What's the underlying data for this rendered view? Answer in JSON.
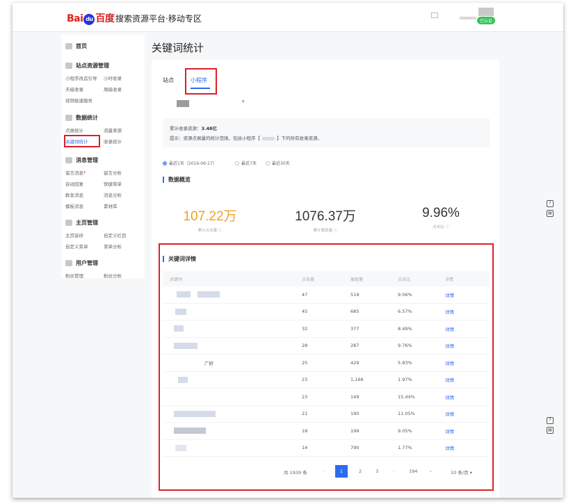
{
  "header": {
    "logo_bai": "Bai",
    "logo_paw": "du",
    "logo_du": "百度",
    "platform": "搜索资源平台·移动专区",
    "badge": "已认证"
  },
  "sidebar": {
    "home": "首页",
    "groups": [
      {
        "title": "站点资源管理",
        "items": [
          "小程序改造引导",
          "小时收录",
          "天级收录",
          "周级收录",
          "视频极速服务"
        ]
      },
      {
        "title": "数据统计",
        "items": [
          "点展统计",
          "流量来源",
          "关键词统计",
          "收录统计"
        ]
      },
      {
        "title": "消息管理",
        "items": [
          "留言消息",
          "留言分析",
          "自动回复",
          "快捷菜单",
          "群发消息",
          "消息分析",
          "模板消息",
          "素材库"
        ]
      },
      {
        "title": "主页管理",
        "items": [
          "主页装修",
          "自定义栏目",
          "自定义菜单",
          "菜单分析"
        ]
      },
      {
        "title": "用户管理",
        "items": [
          "粉丝管理",
          "粉丝分析"
        ]
      }
    ]
  },
  "page_title": "关键词统计",
  "tabs": {
    "site": "站点",
    "mini": "小程序"
  },
  "info": {
    "line1_label": "累计收录资源：",
    "line1_value": "3.48亿",
    "line2_prefix": "提示：资源点展量的统计范围，包括小程序【",
    "line2_suffix": "】下的所有收录资源。"
  },
  "ranges": {
    "day": "最近1天（2019-06-17）",
    "week": "最近7天",
    "month": "最近30天"
  },
  "overview": {
    "title": "数据概览",
    "stats": [
      {
        "value": "107.22万",
        "label": "累计点击量"
      },
      {
        "value": "1076.37万",
        "label": "累计展现量"
      },
      {
        "value": "9.96%",
        "label": "点击比"
      }
    ]
  },
  "keywords": {
    "title": "关键词详情",
    "columns": [
      "关键词",
      "点击量",
      "展现量",
      "点击比",
      "详情"
    ],
    "rows": [
      {
        "kw": "",
        "clicks": "47",
        "views": "519",
        "ratio": "9.06%",
        "detail": "详情"
      },
      {
        "kw": "",
        "clicks": "45",
        "views": "685",
        "ratio": "6.57%",
        "detail": "详情"
      },
      {
        "kw": "",
        "clicks": "32",
        "views": "377",
        "ratio": "8.49%",
        "detail": "详情"
      },
      {
        "kw": "",
        "clicks": "28",
        "views": "287",
        "ratio": "9.76%",
        "detail": "详情"
      },
      {
        "kw": "广好",
        "clicks": "25",
        "views": "429",
        "ratio": "5.83%",
        "detail": "详情"
      },
      {
        "kw": "",
        "clicks": "23",
        "views": "1,166",
        "ratio": "1.97%",
        "detail": "详情"
      },
      {
        "kw": "",
        "clicks": "23",
        "views": "149",
        "ratio": "15.44%",
        "detail": "详情"
      },
      {
        "kw": "",
        "clicks": "21",
        "views": "190",
        "ratio": "11.05%",
        "detail": "详情"
      },
      {
        "kw": "",
        "clicks": "18",
        "views": "199",
        "ratio": "9.05%",
        "detail": "详情"
      },
      {
        "kw": "",
        "clicks": "14",
        "views": "790",
        "ratio": "1.77%",
        "detail": "详情"
      }
    ]
  },
  "pager": {
    "total": "共 1939 条",
    "p1": "1",
    "p2": "2",
    "p3": "3",
    "ellipsis": "···",
    "last": "194",
    "prev": "‹",
    "next": "›",
    "size": "10 条/页 ▾"
  },
  "colors": {
    "accent": "#2d6bf0",
    "highlight": "#d9202a",
    "orange": "#f0a020",
    "badge": "#34c35a"
  }
}
